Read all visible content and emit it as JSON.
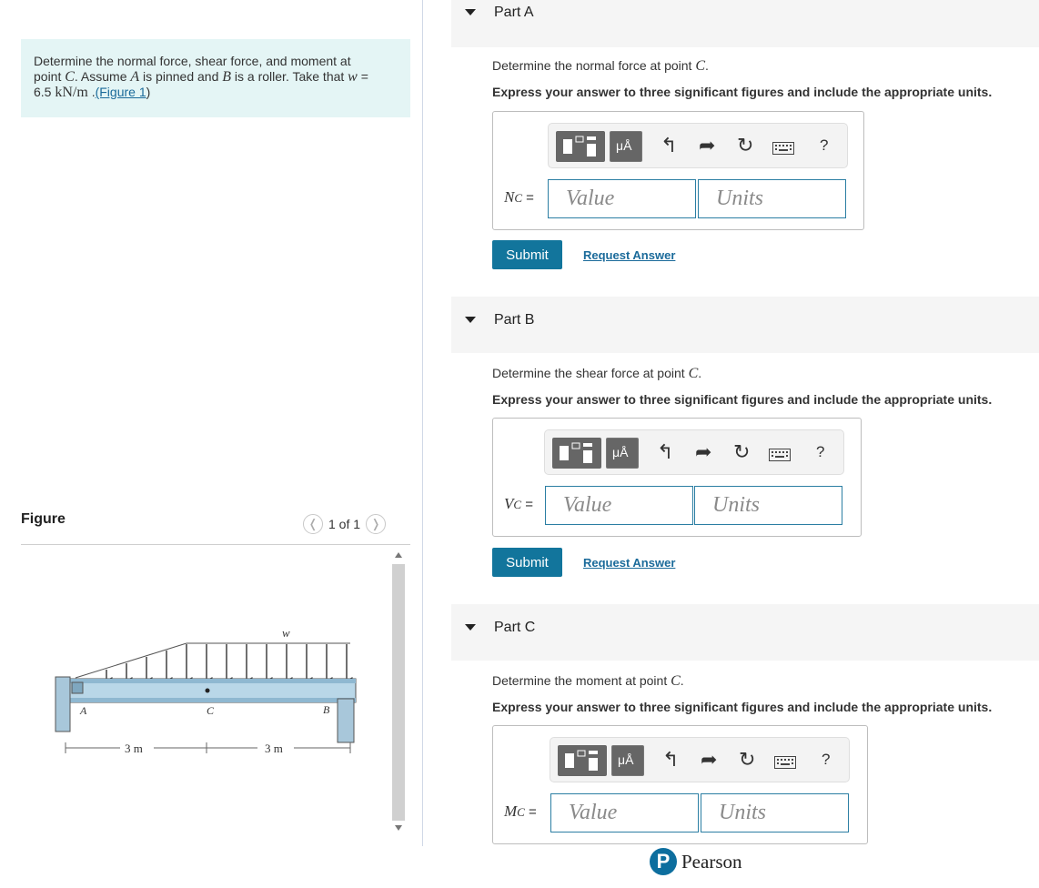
{
  "problem": {
    "text1": "Determine the normal force, shear force, and moment at",
    "text2a": "point ",
    "point": "C",
    "text2b": ". Assume ",
    "pinA": "A",
    "text2c": " is pinned and ",
    "rollerB": "B",
    "text2d": " is a roller. Take that ",
    "w_var": "w",
    "text2e": " =",
    "value": "6.5 ",
    "unit": "kN/m",
    "text3": " .",
    "figure_link": "(Figure 1",
    "paren_close": ")"
  },
  "figure": {
    "heading": "Figure",
    "pager": "1 of 1",
    "prev_icon": "chevron-left-icon",
    "next_icon": "chevron-right-icon",
    "labels": {
      "w": "w",
      "A": "A",
      "C": "C",
      "B": "B",
      "dim1": "3 m",
      "dim2": "3 m"
    }
  },
  "parts": [
    {
      "title": "Part A",
      "question_pre": "Determine the normal force at point ",
      "question_var": "C",
      "question_post": ".",
      "instruction": "Express your answer to three significant figures and include the appropriate units.",
      "label_main": "N",
      "label_sub": "C",
      "label_eq": " =",
      "value_placeholder": "Value",
      "units_placeholder": "Units",
      "submit": "Submit",
      "request": "Request Answer"
    },
    {
      "title": "Part B",
      "question_pre": "Determine the shear force at point ",
      "question_var": "C",
      "question_post": ".",
      "instruction": "Express your answer to three significant figures and include the appropriate units.",
      "label_main": "V",
      "label_sub": "C",
      "label_eq": " =",
      "value_placeholder": "Value",
      "units_placeholder": "Units",
      "submit": "Submit",
      "request": "Request Answer"
    },
    {
      "title": "Part C",
      "question_pre": "Determine the moment at point ",
      "question_var": "C",
      "question_post": ".",
      "instruction": "Express your answer to three significant figures and include the appropriate units.",
      "label_main": "M",
      "label_sub": "C",
      "label_eq": " =",
      "value_placeholder": "Value",
      "units_placeholder": "Units"
    }
  ],
  "toolbar": {
    "units_button": "μÅ",
    "help": "?",
    "icons": [
      "templates-icon",
      "units-icon",
      "undo-icon",
      "redo-icon",
      "reset-icon",
      "keyboard-icon",
      "help-icon"
    ]
  },
  "brand": {
    "logo_letter": "P",
    "name": "Pearson",
    "color": "#0d6e9e"
  },
  "colors": {
    "accent": "#12759c",
    "problem_bg": "#e4f5f5",
    "link": "#1a6a9a"
  }
}
